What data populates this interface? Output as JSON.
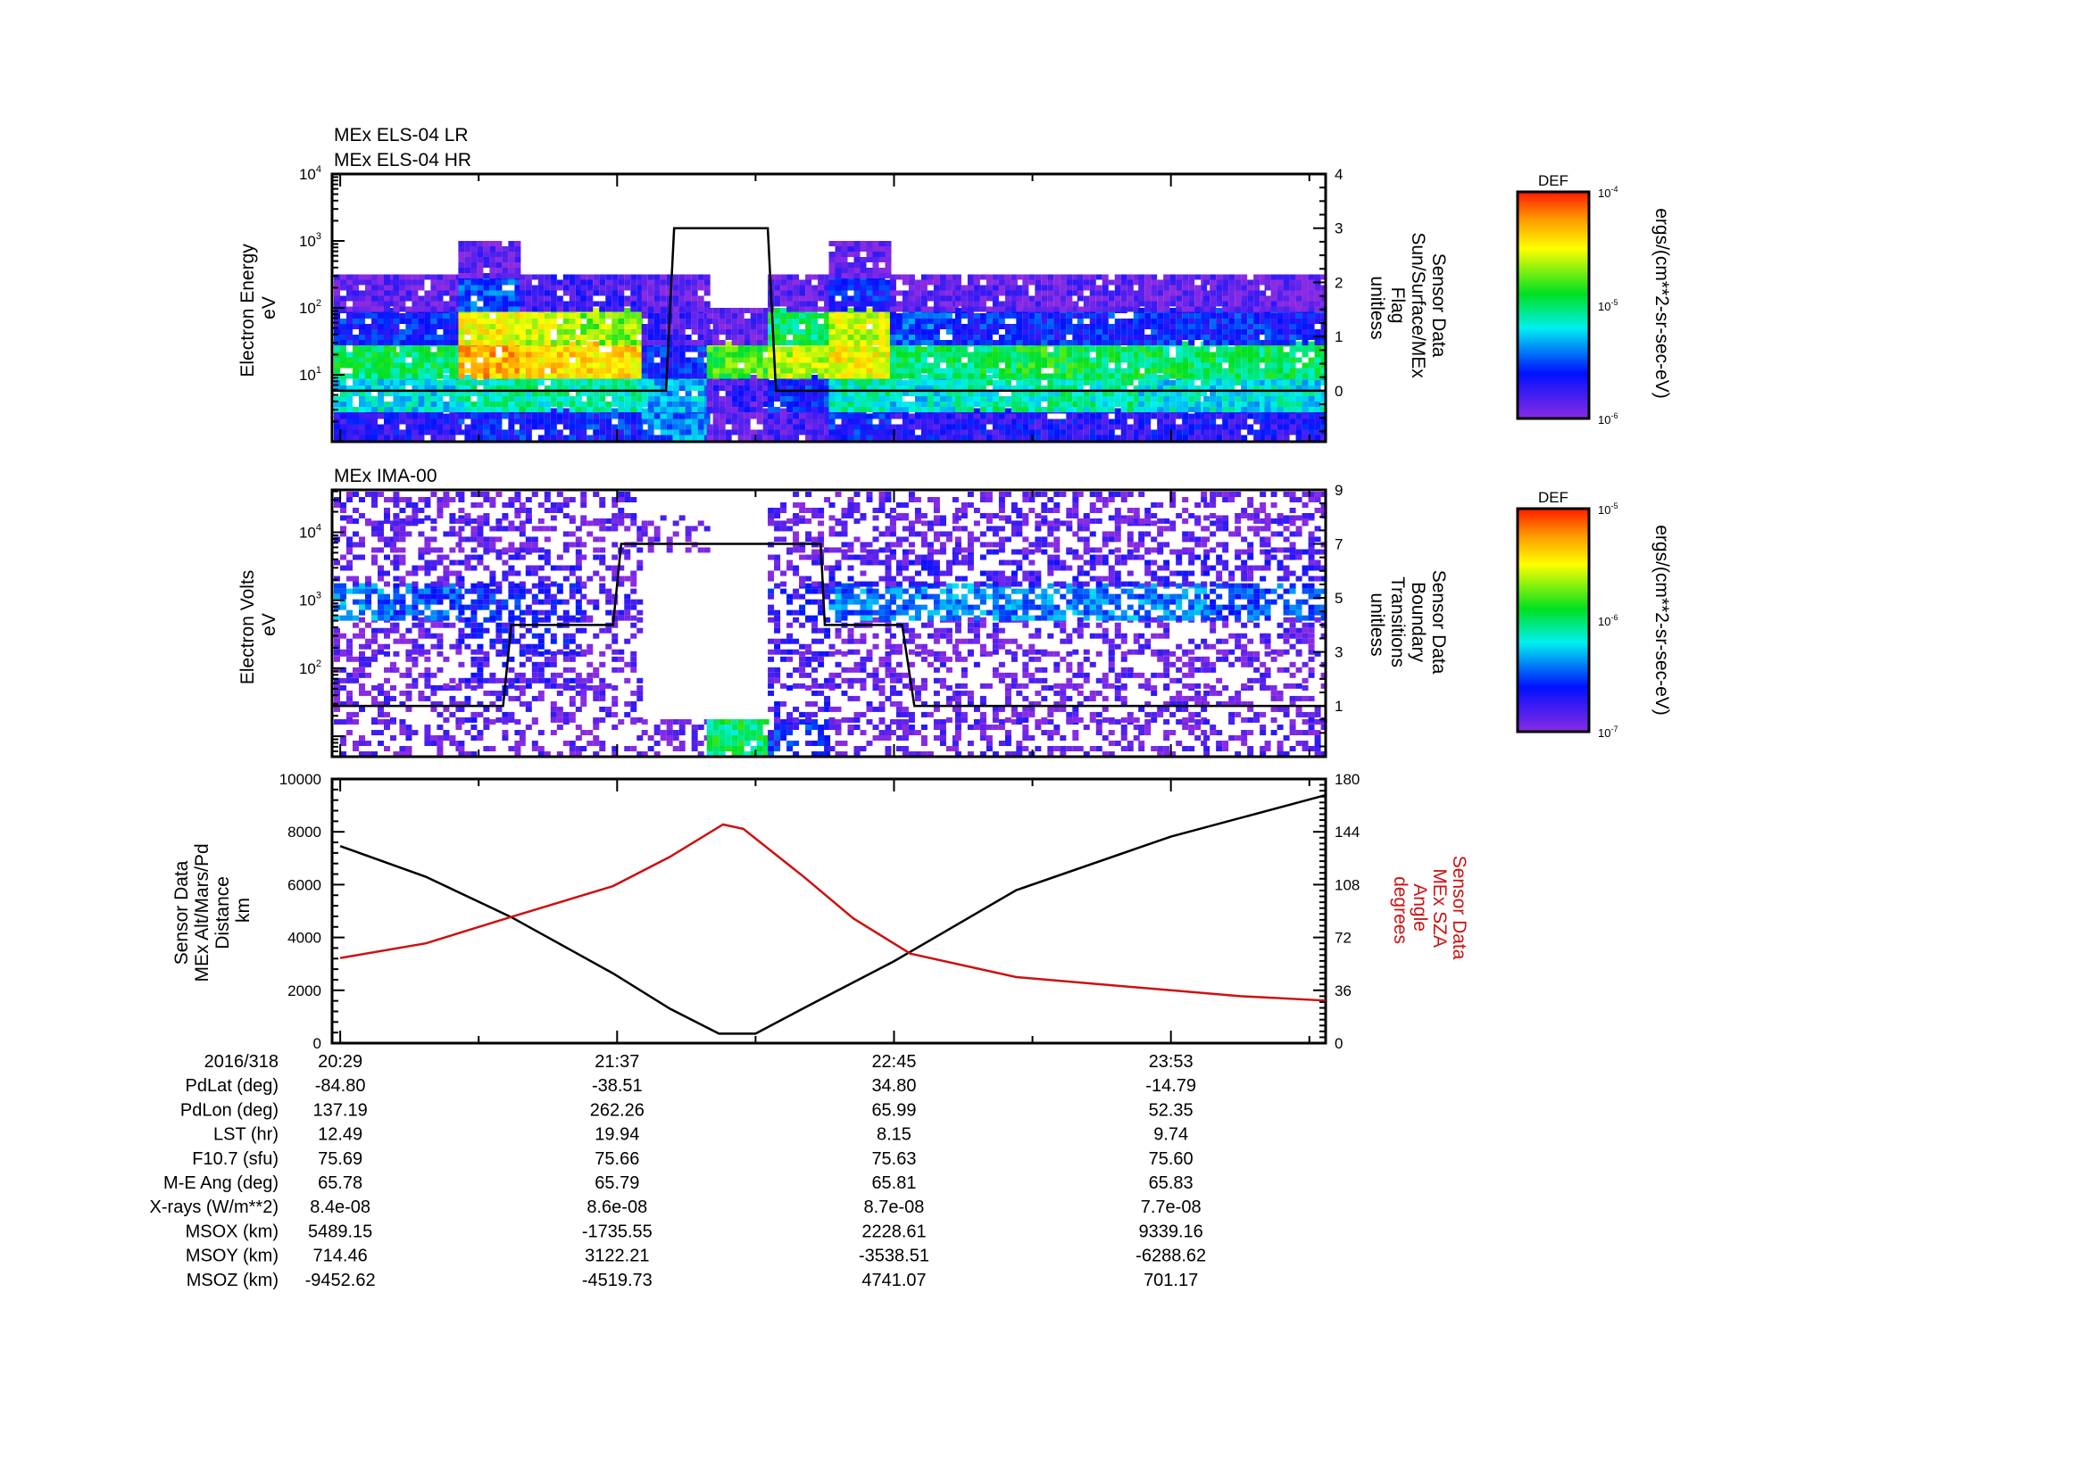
{
  "chart_data": [
    {
      "type": "heatmap",
      "titles": [
        "MEx ELS-04 LR",
        "MEx ELS-04 HR"
      ],
      "ylabel": [
        "Electron Energy",
        "eV"
      ],
      "yscale": "log",
      "ylim": [
        1,
        10000
      ],
      "yticks": [
        {
          "base": "10",
          "exp": "4",
          "v": 10000
        },
        {
          "base": "10",
          "exp": "3",
          "v": 1000
        },
        {
          "base": "10",
          "exp": "2",
          "v": 100
        },
        {
          "base": "10",
          "exp": "1",
          "v": 10
        }
      ],
      "xlim": [
        "20:27",
        "00:31"
      ],
      "energy_bin_centers_log10_eV": [
        0.25,
        0.75,
        1.25,
        1.75,
        2.25,
        2.75,
        3.25,
        3.75
      ],
      "time_bins_start": [
        "20:27",
        "20:42",
        "20:58",
        "21:13",
        "21:28",
        "21:43",
        "21:59",
        "22:14",
        "22:29",
        "22:44",
        "23:00",
        "23:15",
        "23:30",
        "23:45",
        "24:01",
        "00:16"
      ],
      "log10_def": [
        [
          -5.7,
          -5.2,
          -5.0,
          -5.6,
          -5.9,
          null,
          null,
          null
        ],
        [
          -5.7,
          -5.2,
          -5.0,
          -5.6,
          -5.9,
          null,
          null,
          null
        ],
        [
          -5.6,
          -5.1,
          -4.3,
          -4.5,
          -5.5,
          -5.9,
          null,
          null
        ],
        [
          -5.6,
          -5.1,
          -4.4,
          -4.6,
          -5.8,
          null,
          null,
          null
        ],
        [
          -5.6,
          -5.1,
          -4.4,
          -4.7,
          -5.8,
          null,
          null,
          null
        ],
        [
          -5.4,
          -5.3,
          -5.6,
          -5.8,
          -5.9,
          null,
          null,
          null
        ],
        [
          -5.9,
          -5.8,
          -4.8,
          -5.9,
          null,
          null,
          null,
          null
        ],
        [
          -5.8,
          -5.6,
          -4.6,
          -5.0,
          -5.9,
          null,
          null,
          null
        ],
        [
          -5.6,
          -5.1,
          -4.5,
          -4.6,
          -5.6,
          -5.9,
          null,
          null
        ],
        [
          -5.7,
          -5.2,
          -5.0,
          -5.5,
          -5.9,
          null,
          null,
          null
        ],
        [
          -5.7,
          -5.1,
          -5.0,
          -5.6,
          -5.9,
          null,
          null,
          null
        ],
        [
          -5.7,
          -5.1,
          -4.9,
          -5.6,
          -5.9,
          null,
          null,
          null
        ],
        [
          -5.7,
          -5.1,
          -5.0,
          -5.6,
          -5.9,
          null,
          null,
          null
        ],
        [
          -5.7,
          -5.2,
          -5.0,
          -5.6,
          -5.9,
          null,
          null,
          null
        ],
        [
          -5.7,
          -5.2,
          -5.0,
          -5.6,
          -5.9,
          null,
          null,
          null
        ],
        [
          -5.7,
          -5.2,
          -5.0,
          -5.6,
          -5.9,
          null,
          null,
          null
        ]
      ],
      "colorbar": {
        "label": "DEF",
        "units": "ergs/(cm**2-sr-sec-eV)",
        "range_log10": [
          -6,
          -4
        ],
        "ticks": [
          {
            "base": "10",
            "exp": "-4"
          },
          {
            "base": "10",
            "exp": "-5"
          },
          {
            "base": "10",
            "exp": "-6"
          }
        ]
      },
      "overlay": {
        "ylabel": [
          "Sensor Data",
          "Sun/Surface/MEx",
          "Flag",
          "unitless"
        ],
        "ylim": [
          -0.94,
          4
        ],
        "yticks": [
          "0",
          "1",
          "2",
          "3",
          "4"
        ],
        "color": "#000000",
        "points": [
          [
            "20:27",
            0
          ],
          [
            "21:49",
            0
          ],
          [
            "21:51",
            3
          ],
          [
            "22:14",
            3
          ],
          [
            "22:16",
            0
          ],
          [
            "00:31",
            0
          ]
        ]
      }
    },
    {
      "type": "heatmap",
      "titles": [
        "MEx IMA-00"
      ],
      "ylabel": [
        "Electron Volts",
        "eV"
      ],
      "yscale": "log",
      "ylim": [
        5,
        42000
      ],
      "yticks": [
        {
          "base": "10",
          "exp": "4",
          "v": 10000
        },
        {
          "base": "10",
          "exp": "3",
          "v": 1000
        },
        {
          "base": "10",
          "exp": "2",
          "v": 100
        }
      ],
      "xlim": [
        "20:27",
        "00:31"
      ],
      "energy_bin_centers_log10_eV": [
        1.0,
        1.5,
        2.0,
        2.5,
        3.0,
        3.5,
        4.0,
        4.4
      ],
      "time_bins_start": [
        "20:27",
        "20:42",
        "20:58",
        "21:13",
        "21:28",
        "21:43",
        "21:59",
        "22:14",
        "22:29",
        "22:44",
        "23:00",
        "23:15",
        "23:30",
        "23:45",
        "24:01",
        "00:16"
      ],
      "log10_def": [
        [
          -6.9,
          -6.9,
          -6.9,
          -6.9,
          -6.4,
          -6.9,
          -6.9,
          -6.9
        ],
        [
          -6.9,
          -6.9,
          -6.9,
          -6.9,
          -6.5,
          -6.9,
          -6.9,
          -6.9
        ],
        [
          -6.9,
          -6.8,
          -6.8,
          -6.7,
          -6.6,
          -6.8,
          -6.9,
          -6.9
        ],
        [
          -6.9,
          -6.9,
          -6.8,
          -6.7,
          -6.7,
          -6.8,
          -6.9,
          -6.9
        ],
        [
          -6.9,
          -6.9,
          -6.9,
          -6.9,
          -6.8,
          -6.9,
          -6.9,
          -6.9
        ],
        [
          -6.9,
          null,
          null,
          null,
          null,
          null,
          -6.95,
          null
        ],
        [
          -6.0,
          null,
          null,
          null,
          null,
          null,
          null,
          null
        ],
        [
          -6.6,
          -6.8,
          -6.8,
          -6.8,
          -6.7,
          -6.9,
          -6.9,
          -6.9
        ],
        [
          -6.9,
          -6.9,
          -6.9,
          -6.9,
          -6.4,
          -6.8,
          -6.9,
          -6.9
        ],
        [
          -6.9,
          -6.9,
          -6.9,
          -6.9,
          -6.4,
          -6.8,
          -6.9,
          -6.9
        ],
        [
          -6.9,
          -6.9,
          -6.9,
          -6.9,
          -6.4,
          -6.8,
          -6.9,
          -6.9
        ],
        [
          -6.9,
          -6.9,
          -6.9,
          -6.9,
          -6.4,
          -6.8,
          -6.9,
          -6.9
        ],
        [
          -6.9,
          -6.9,
          -6.9,
          -6.9,
          -6.4,
          -6.8,
          -6.9,
          -6.9
        ],
        [
          -6.9,
          -6.9,
          -6.9,
          -6.9,
          -6.4,
          -6.8,
          -6.9,
          -6.9
        ],
        [
          -6.9,
          -6.9,
          -6.9,
          -6.9,
          -6.5,
          -6.8,
          -6.9,
          -6.9
        ],
        [
          -6.9,
          -6.9,
          -6.9,
          -6.9,
          -6.5,
          -6.8,
          -6.9,
          -6.9
        ]
      ],
      "colorbar": {
        "label": "DEF",
        "units": "ergs/(cm**2-sr-sec-eV)",
        "range_log10": [
          -7,
          -5
        ],
        "ticks": [
          {
            "base": "10",
            "exp": "-5"
          },
          {
            "base": "10",
            "exp": "-6"
          },
          {
            "base": "10",
            "exp": "-7"
          }
        ]
      },
      "overlay": {
        "ylabel": [
          "Sensor Data",
          "Boundary",
          "Transitions",
          "unitless"
        ],
        "ylim": [
          -0.88,
          9
        ],
        "yticks": [
          "1",
          "3",
          "5",
          "7",
          "9"
        ],
        "color": "#000000",
        "points": [
          [
            "20:27",
            1
          ],
          [
            "21:09",
            1
          ],
          [
            "21:11",
            4
          ],
          [
            "21:36",
            4
          ],
          [
            "21:38",
            7
          ],
          [
            "22:27",
            7
          ],
          [
            "22:28",
            4
          ],
          [
            "22:47",
            4
          ],
          [
            "22:50",
            1
          ],
          [
            "00:31",
            1
          ]
        ]
      }
    },
    {
      "type": "line",
      "xlim": [
        "20:27",
        "00:31"
      ],
      "series": [
        {
          "axis": "left",
          "color": "#000000",
          "ylabel": [
            "Sensor Data",
            "MEx Alt/Mars/Pd",
            "Distance",
            "km"
          ],
          "ylim": [
            0,
            10000
          ],
          "yticks": [
            "0",
            "2000",
            "4000",
            "6000",
            "8000",
            "10000"
          ],
          "points": [
            [
              "20:29",
              7460
            ],
            [
              "20:50",
              6300
            ],
            [
              "21:11",
              4770
            ],
            [
              "21:36",
              2640
            ],
            [
              "21:50",
              1300
            ],
            [
              "22:02",
              360
            ],
            [
              "22:11",
              360
            ],
            [
              "22:25",
              1500
            ],
            [
              "22:45",
              3100
            ],
            [
              "23:15",
              5790
            ],
            [
              "23:53",
              7820
            ],
            [
              "00:31",
              9390
            ]
          ]
        },
        {
          "axis": "right",
          "color": "#cc1111",
          "ylabel": [
            "Sensor Data",
            "MEx SZA",
            "Angle",
            "degrees"
          ],
          "ylim": [
            0,
            180
          ],
          "yticks": [
            "0",
            "36",
            "72",
            "108",
            "144",
            "180"
          ],
          "points": [
            [
              "20:29",
              58
            ],
            [
              "20:50",
              68
            ],
            [
              "21:11",
              86
            ],
            [
              "21:36",
              107
            ],
            [
              "21:50",
              127
            ],
            [
              "22:03",
              149
            ],
            [
              "22:08",
              146
            ],
            [
              "22:23",
              113
            ],
            [
              "22:35",
              85
            ],
            [
              "22:49",
              61
            ],
            [
              "23:15",
              45
            ],
            [
              "23:53",
              36
            ],
            [
              "00:10",
              32
            ],
            [
              "00:31",
              29
            ]
          ]
        }
      ]
    }
  ],
  "annotations": {
    "rows": [
      {
        "label": "2016/318",
        "values": [
          "20:29",
          "21:37",
          "22:45",
          "23:53"
        ]
      },
      {
        "label": "PdLat (deg)",
        "values": [
          "-84.80",
          "-38.51",
          "34.80",
          "-14.79"
        ]
      },
      {
        "label": "PdLon (deg)",
        "values": [
          "137.19",
          "262.26",
          "65.99",
          "52.35"
        ]
      },
      {
        "label": "LST (hr)",
        "values": [
          "12.49",
          "19.94",
          "8.15",
          "9.74"
        ]
      },
      {
        "label": "F10.7 (sfu)",
        "values": [
          "75.69",
          "75.66",
          "75.63",
          "75.60"
        ]
      },
      {
        "label": "M-E Ang (deg)",
        "values": [
          "65.78",
          "65.79",
          "65.81",
          "65.83"
        ]
      },
      {
        "label": "X-rays (W/m**2)",
        "values": [
          "8.4e-08",
          "8.6e-08",
          "8.7e-08",
          "7.7e-08"
        ]
      },
      {
        "label": "MSOX (km)",
        "values": [
          "5489.15",
          "-1735.55",
          "2228.61",
          "9339.16"
        ]
      },
      {
        "label": "MSOY (km)",
        "values": [
          "714.46",
          "3122.21",
          "-3538.51",
          "-6288.62"
        ]
      },
      {
        "label": "MSOZ (km)",
        "values": [
          "-9452.62",
          "-4519.73",
          "4741.07",
          "701.17"
        ]
      }
    ]
  }
}
